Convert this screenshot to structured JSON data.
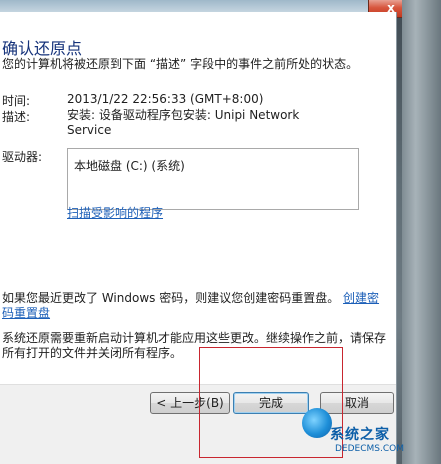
{
  "window": {
    "close_glyph": "x"
  },
  "page": {
    "heading": "确认还原点",
    "description": "您的计算机将被还原到下面 “描述” 字段中的事件之前所处的状态。"
  },
  "details": {
    "time_label": "时间:",
    "time_value": "2013/1/22 22:56:33 (GMT+8:00)",
    "desc_label": "描述:",
    "desc_value_line1": "安装: 设备驱动程序包安装: Unipi Network",
    "desc_value_line2": "Service",
    "drives_label": "驱动器:",
    "drives": [
      "本地磁盘 (C:) (系统)"
    ],
    "scan_link": "扫描受影响的程序"
  },
  "notes": {
    "password_text": "如果您最近更改了 Windows 密码，则建议您创建密码重置盘。",
    "password_link": "创建密码重置盘",
    "restart_text": "系统还原需要重新启动计算机才能应用这些更改。继续操作之前，请保存所有打开的文件并关闭所有程序。"
  },
  "buttons": {
    "back": "< 上一步(B)",
    "finish": "完成",
    "cancel": "取消"
  },
  "watermark": {
    "text": "系统之家",
    "site": "DEDECMS.COM"
  },
  "colors": {
    "heading": "#15327a",
    "link": "#1c5fb8",
    "highlight_frame": "#c8262f"
  }
}
